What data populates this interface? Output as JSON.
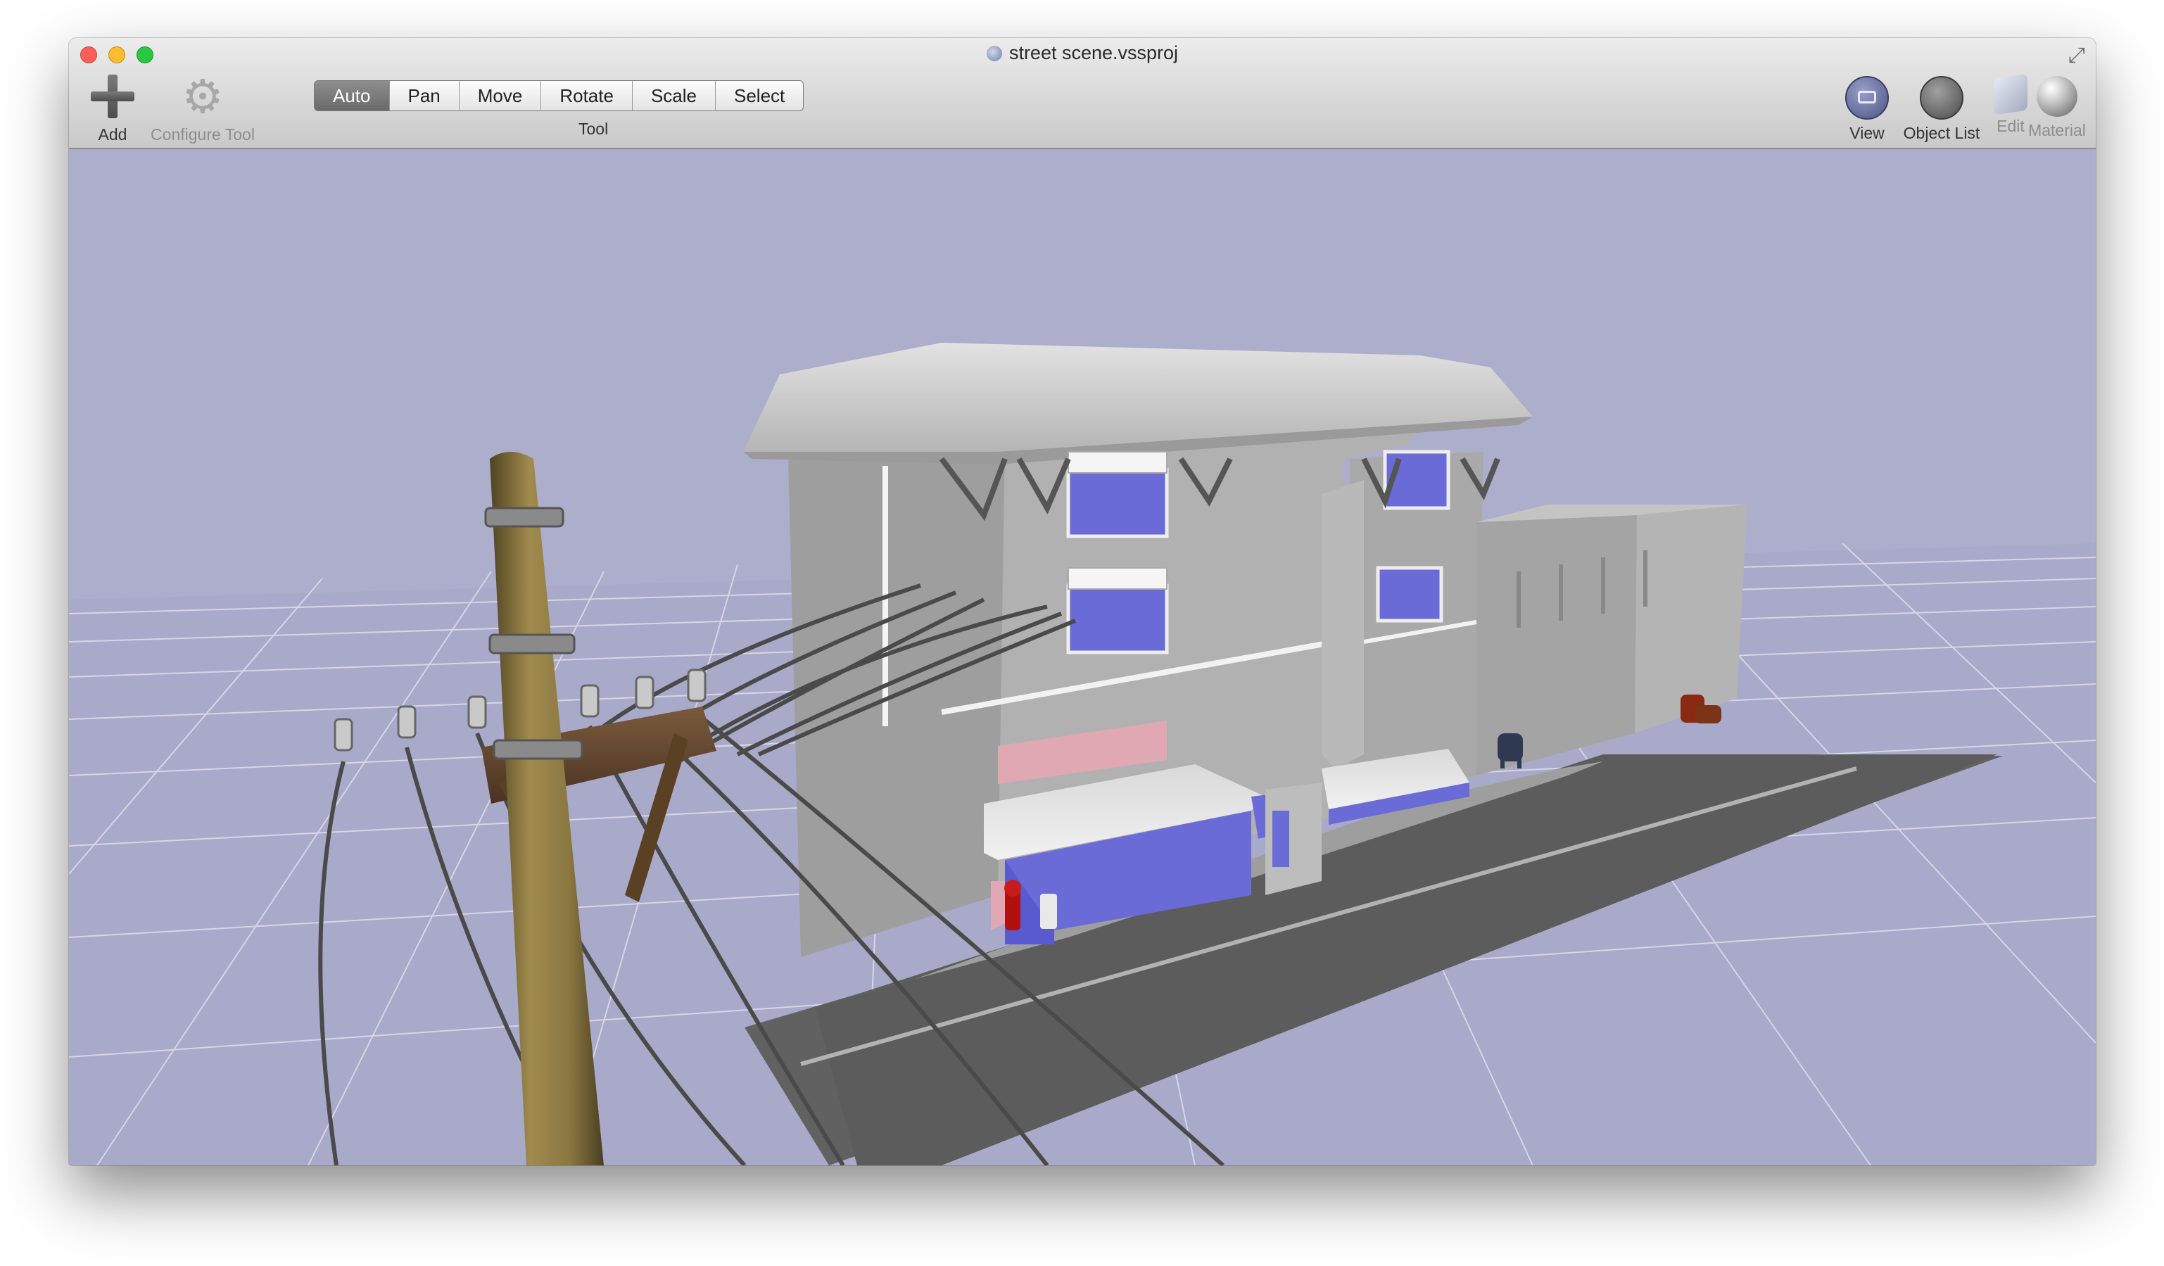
{
  "window": {
    "title": "street scene.vssproj"
  },
  "toolbar": {
    "add_label": "Add",
    "configure_label": "Configure Tool",
    "tool_modes": [
      "Auto",
      "Pan",
      "Move",
      "Rotate",
      "Scale",
      "Select"
    ],
    "active_mode": "Auto",
    "tool_group_label": "Tool",
    "view_label": "View",
    "object_list_label": "Object List",
    "edit_label": "Edit",
    "material_label": "Material"
  },
  "colors": {
    "viewport_bg": "#adadcc",
    "grid_line": "#d6d6e6",
    "building": "#aaaaaa",
    "window_glass": "#6b6bd8",
    "street": "#616161",
    "pole_wood": "#8a7742"
  },
  "icons": {
    "add": "plus-icon",
    "configure": "gear-icon",
    "view": "camera-icon",
    "object_list": "object-list-icon",
    "edit": "cube-icon",
    "material": "sphere-icon"
  }
}
